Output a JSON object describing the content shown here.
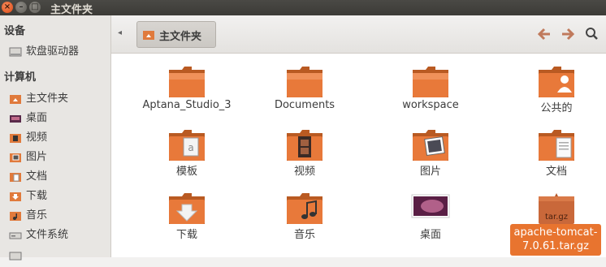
{
  "window": {
    "title": "主文件夹",
    "close_glyph": "×",
    "min_glyph": "–",
    "max_glyph": "□"
  },
  "sidebar": {
    "sections": [
      {
        "heading": "设备",
        "items": [
          {
            "label": "软盘驱动器",
            "icon": "floppy-drive-icon"
          }
        ]
      },
      {
        "heading": "计算机",
        "items": [
          {
            "label": "主文件夹",
            "icon": "home-folder-icon"
          },
          {
            "label": "桌面",
            "icon": "desktop-icon"
          },
          {
            "label": "视频",
            "icon": "video-folder-icon"
          },
          {
            "label": "图片",
            "icon": "pictures-folder-icon"
          },
          {
            "label": "文档",
            "icon": "documents-folder-icon"
          },
          {
            "label": "下载",
            "icon": "downloads-folder-icon"
          },
          {
            "label": "音乐",
            "icon": "music-folder-icon"
          },
          {
            "label": "文件系统",
            "icon": "filesystem-icon"
          }
        ]
      }
    ]
  },
  "toolbar": {
    "breadcrumb_label": "主文件夹",
    "back_glyph": "🡐",
    "forward_glyph": "🡒",
    "search_glyph": "⚲"
  },
  "files": [
    {
      "name": "Aptana_Studio_3",
      "icon": "folder-icon"
    },
    {
      "name": "Documents",
      "icon": "folder-icon"
    },
    {
      "name": "workspace",
      "icon": "folder-icon"
    },
    {
      "name": "公共的",
      "icon": "public-folder-icon"
    },
    {
      "name": "模板",
      "icon": "templates-folder-icon"
    },
    {
      "name": "视频",
      "icon": "video-folder-icon"
    },
    {
      "name": "图片",
      "icon": "pictures-folder-icon"
    },
    {
      "name": "文档",
      "icon": "documents-folder-icon"
    },
    {
      "name": "下载",
      "icon": "downloads-folder-icon"
    },
    {
      "name": "音乐",
      "icon": "music-folder-icon"
    },
    {
      "name": "桌面",
      "icon": "desktop-folder-icon"
    },
    {
      "name": "apache-tomcat-7.0.61.tar.gz",
      "icon": "archive-icon",
      "badge": "tar.gz",
      "selected": true
    }
  ],
  "selected_label_lines": [
    "apache-tomcat-",
    "7.0.61.tar.gz"
  ],
  "colors": {
    "accent": "#e8742f",
    "folder": "#e0783b",
    "titlebar": "#3c3b37"
  }
}
